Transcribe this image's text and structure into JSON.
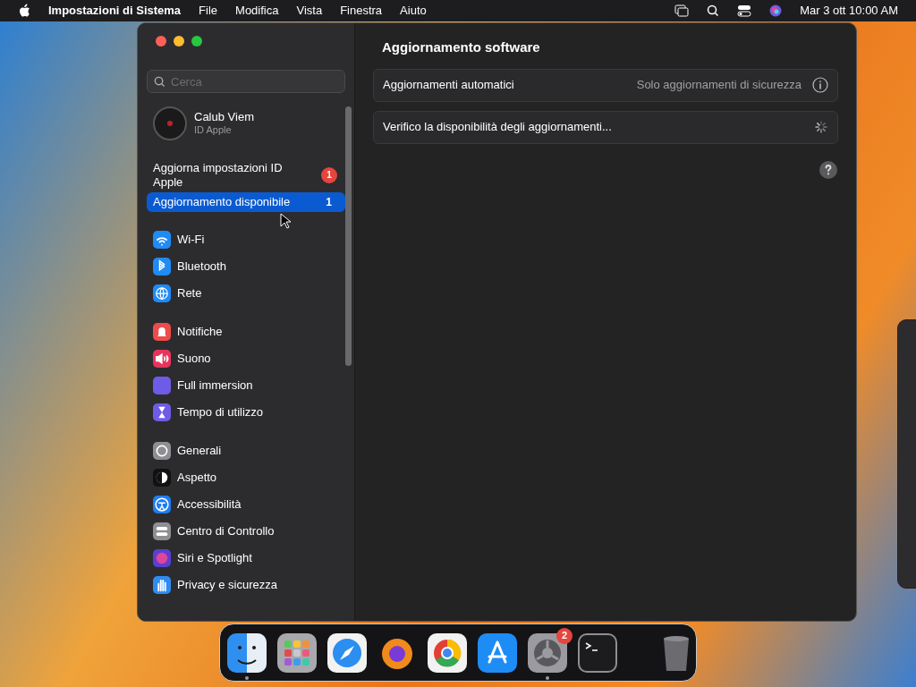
{
  "menu_bar": {
    "app_name": "Impostazioni di Sistema",
    "menus": [
      "File",
      "Modifica",
      "Vista",
      "Finestra",
      "Aiuto"
    ],
    "clock": "Mar 3 ott 10:00 AM"
  },
  "sidebar": {
    "search": {
      "placeholder": "Cerca"
    },
    "account": {
      "name": "Calub Viem",
      "subtitle": "ID Apple"
    },
    "notices": [
      {
        "label": "Aggiorna impostazioni ID Apple",
        "badge": "1",
        "kind": "alert",
        "selected": false
      },
      {
        "label": "Aggiornamento disponibile",
        "badge": "1",
        "kind": "count",
        "selected": true
      }
    ],
    "groups": [
      [
        {
          "label": "Wi-Fi",
          "selected": false
        },
        {
          "label": "Bluetooth",
          "selected": false
        },
        {
          "label": "Rete",
          "selected": false
        }
      ],
      [
        {
          "label": "Notifiche",
          "selected": false
        },
        {
          "label": "Suono",
          "selected": false
        },
        {
          "label": "Full immersion",
          "selected": false
        },
        {
          "label": "Tempo di utilizzo",
          "selected": false
        }
      ],
      [
        {
          "label": "Generali",
          "selected": false
        },
        {
          "label": "Aspetto",
          "selected": false
        },
        {
          "label": "Accessibilità",
          "selected": false
        },
        {
          "label": "Centro di Controllo",
          "selected": false
        },
        {
          "label": "Siri e Spotlight",
          "selected": false
        },
        {
          "label": "Privacy e sicurezza",
          "selected": false
        }
      ]
    ]
  },
  "content": {
    "title": "Aggiornamento software",
    "rows": [
      {
        "kind": "info",
        "label": "Aggiornamenti automatici",
        "value": "Solo aggiornamenti di sicurezza"
      },
      {
        "kind": "progress",
        "label": "Verifico la disponibilità degli aggiornamenti..."
      }
    ]
  },
  "dock": [
    {
      "running": true
    },
    {
      "running": false
    },
    {
      "running": false
    },
    {
      "running": false
    },
    {
      "running": false
    },
    {
      "running": false
    },
    {
      "running": true,
      "badge": "2"
    },
    {
      "running": false
    },
    {
      "kind": "trash",
      "running": false
    }
  ]
}
